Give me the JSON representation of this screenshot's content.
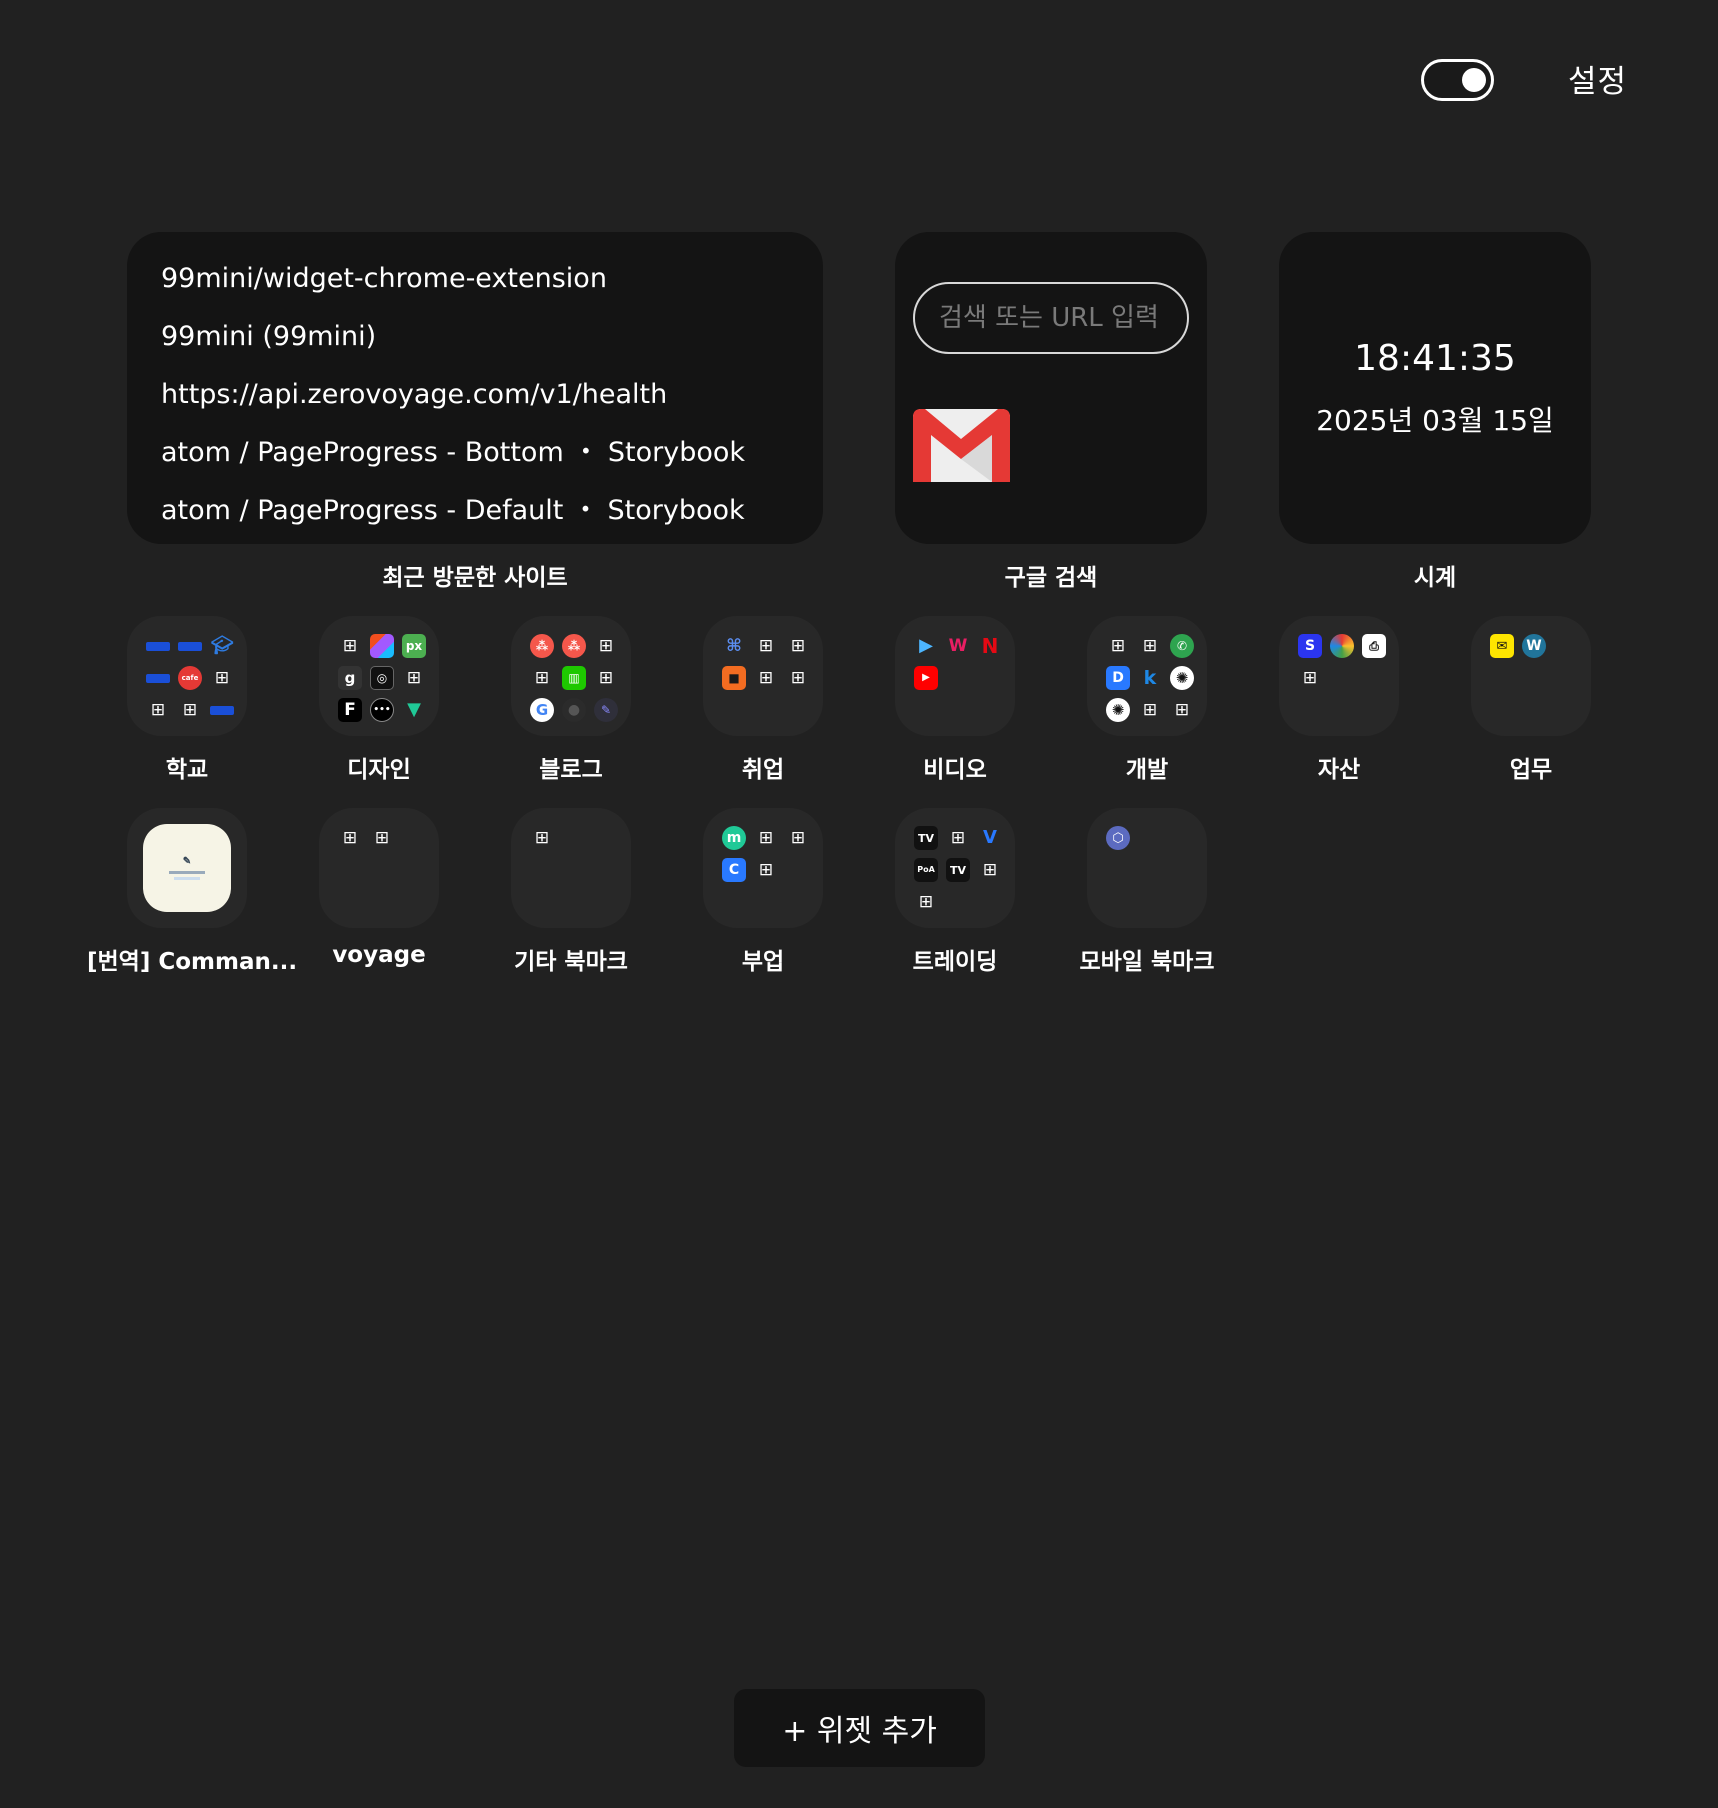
{
  "header": {
    "theme_toggle_state": "on",
    "settings_label": "설정"
  },
  "widgets": {
    "recent": {
      "label": "최근 방문한 사이트",
      "items": [
        "99mini/widget-chrome-extension",
        "99mini (99mini)",
        "https://api.zerovoyage.com/v1/health",
        "atom / PageProgress - Bottom ・ Storybook",
        "atom / PageProgress - Default ・ Storybook"
      ]
    },
    "google": {
      "label": "구글 검색",
      "placeholder": "검색 또는 URL 입력",
      "shortcut_icon": "gmail-icon"
    },
    "clock": {
      "label": "시계",
      "time": "18:41:35",
      "date": "2025년 03월 15일"
    }
  },
  "folders": [
    {
      "label": "학교"
    },
    {
      "label": "디자인"
    },
    {
      "label": "블로그"
    },
    {
      "label": "취업"
    },
    {
      "label": "비디오"
    },
    {
      "label": "개발"
    },
    {
      "label": "자산"
    },
    {
      "label": "업무"
    },
    {
      "label": "[번역] Comman..."
    },
    {
      "label": "voyage"
    },
    {
      "label": "기타 북마크"
    },
    {
      "label": "부업"
    },
    {
      "label": "트레이딩"
    },
    {
      "label": "모바일 북마크"
    }
  ],
  "add_widget_label": "+ 위젯 추가",
  "colors": {
    "background": "#212121",
    "widget_bg": "#141414",
    "folder_bg": "#282828",
    "text": "#ffffff"
  }
}
